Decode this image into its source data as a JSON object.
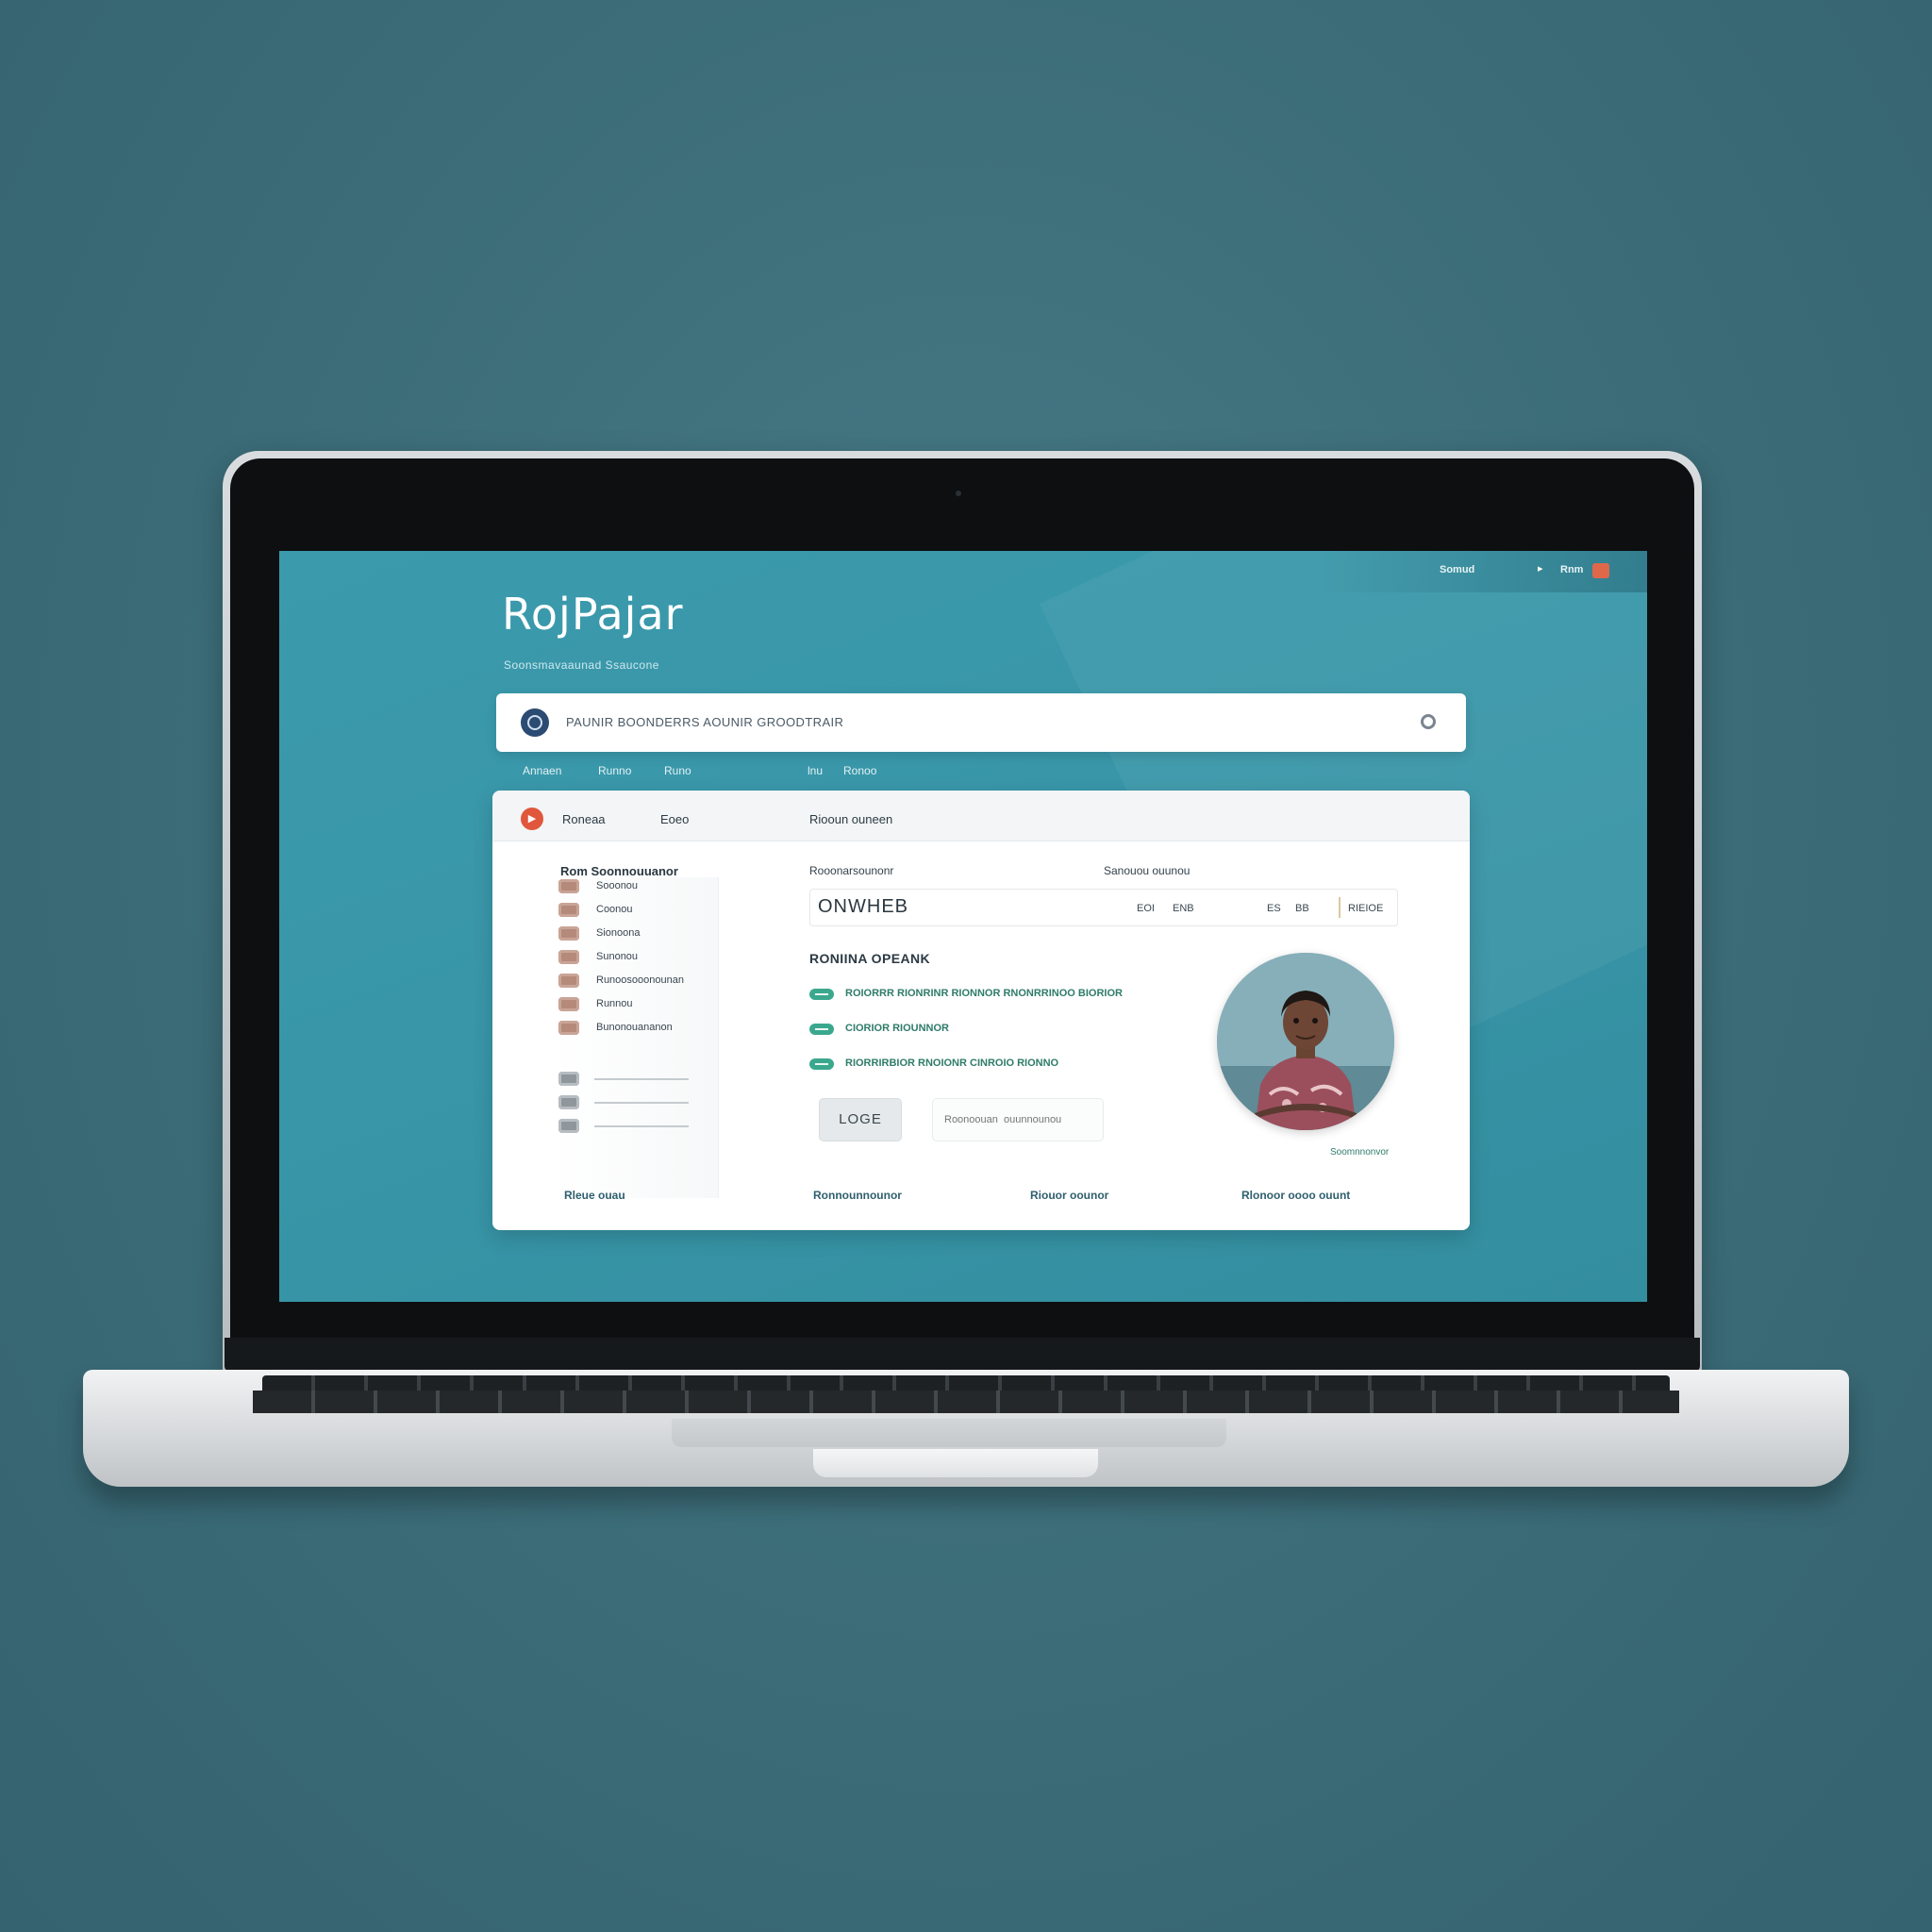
{
  "screen": {
    "topbar": {
      "link": "Somud",
      "arrow": "▸",
      "account": "Rnm"
    },
    "brand": "RojPajar",
    "tagline": "Soonsmavaaunad   Ssaucone",
    "search": {
      "text": "PAUNIR  BOONDERRS  AOUNIR GROODTRAIR"
    },
    "subnav": {
      "item1": "Annaen",
      "item2": "Runno",
      "item3": "Runo",
      "item4": "lnu",
      "item5": "Ronoo"
    },
    "card": {
      "header": {
        "tab1": "Roneaa",
        "tab2": "Eoeo",
        "tab3": "Riooun ouneen"
      },
      "sidebar": {
        "title": "Rom  Soonnouuanor",
        "items": [
          {
            "label": "Sooonou"
          },
          {
            "label": "Coonou"
          },
          {
            "label": "Sionoona"
          },
          {
            "label": "Sunonou"
          },
          {
            "label": "Runoosooonounan"
          },
          {
            "label": "Runnou"
          },
          {
            "label": "Bunonouananon"
          }
        ],
        "extra_count": 3
      },
      "details": {
        "label_left": "Rooonarsounonr",
        "label_right": "Sanouou ouunou",
        "name_value": "ONWHEB",
        "mini1": "EOI",
        "mini2": "ENB",
        "mini3": "ES",
        "mini4": "BB",
        "mini5": "RIEIOE"
      },
      "features": {
        "title": "RONIINA OPEANK",
        "items": [
          {
            "text": "ROIORRR RIONRINR RIONNOR  RNONRRINOO  BIORIOR"
          },
          {
            "text": "CIORIOR RIOUNNOR"
          },
          {
            "text": "RIORRIRBIOR RNOIONR CINROIO RIONNO"
          }
        ]
      },
      "buttons": {
        "primary": "LOGE",
        "secondary_placeholder": "Roonoouan  ouunnounou"
      },
      "avatar_caption": "Soomnnonvor",
      "footer": {
        "link1": "Rleue ouau",
        "link2": "Ronnounnounor",
        "link3": "Riouor oounor",
        "link4": "Rlonoor oooo ouunt"
      }
    }
  },
  "colors": {
    "background": "#3d6e7a",
    "screen": "#3896a8",
    "accent_orange": "#e0684a",
    "accent_green": "#3ba88e",
    "navy": "#2c4b73"
  }
}
